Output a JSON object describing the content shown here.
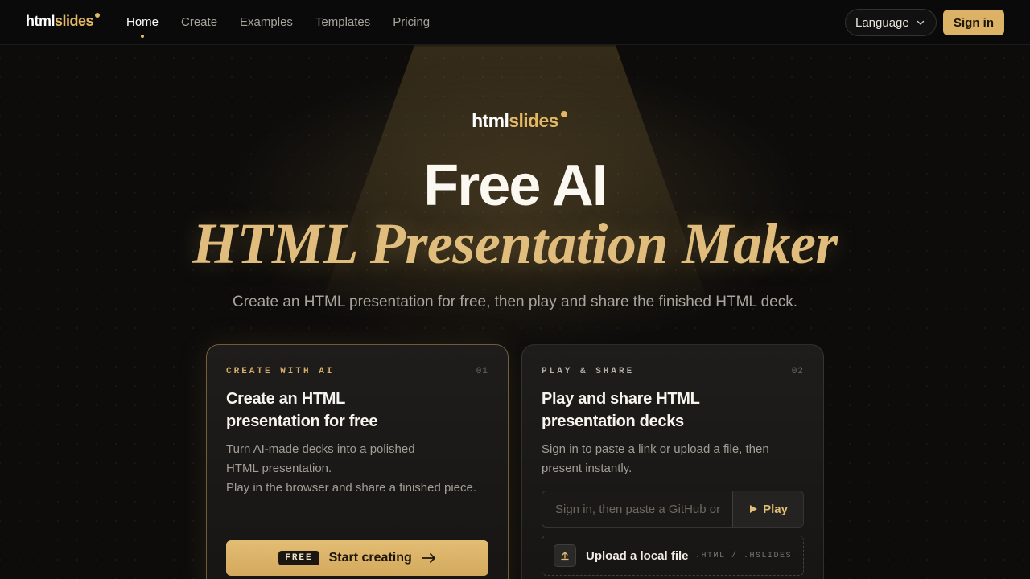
{
  "nav": {
    "logo_a": "html",
    "logo_b": "slides",
    "links": [
      "Home",
      "Create",
      "Examples",
      "Templates",
      "Pricing"
    ],
    "active_index": 0,
    "language_label": "Language",
    "signin_label": "Sign in"
  },
  "hero": {
    "logo_a": "html",
    "logo_b": "slides",
    "title_line1": "Free AI",
    "title_line2": "HTML Presentation Maker",
    "subtitle": "Create an HTML presentation for free, then play and share the finished HTML deck."
  },
  "cards": [
    {
      "eyebrow": "CREATE WITH AI",
      "number": "01",
      "title_line1": "Create an HTML",
      "title_line2": "presentation for free",
      "desc_lines": [
        "Turn AI-made decks into a polished",
        "HTML presentation.",
        "Play in the browser and share a finished piece."
      ],
      "badge": "FREE",
      "cta_label": "Start creating"
    },
    {
      "eyebrow": "PLAY & SHARE",
      "number": "02",
      "title_line1": "Play and share HTML",
      "title_line2": "presentation decks",
      "desc_lines": [
        "Sign in to paste a link or upload a file, then",
        "present instantly."
      ],
      "input_placeholder": "Sign in, then paste a GitHub or",
      "play_label": "Play",
      "upload_label": "Upload a local file",
      "upload_ext": ".HTML / .HSLIDES"
    }
  ],
  "colors": {
    "accent": "#dcb266",
    "background": "#0d0c0b"
  },
  "icons": [
    "chevron-down-icon",
    "arrow-right-icon",
    "play-icon",
    "upload-icon"
  ]
}
